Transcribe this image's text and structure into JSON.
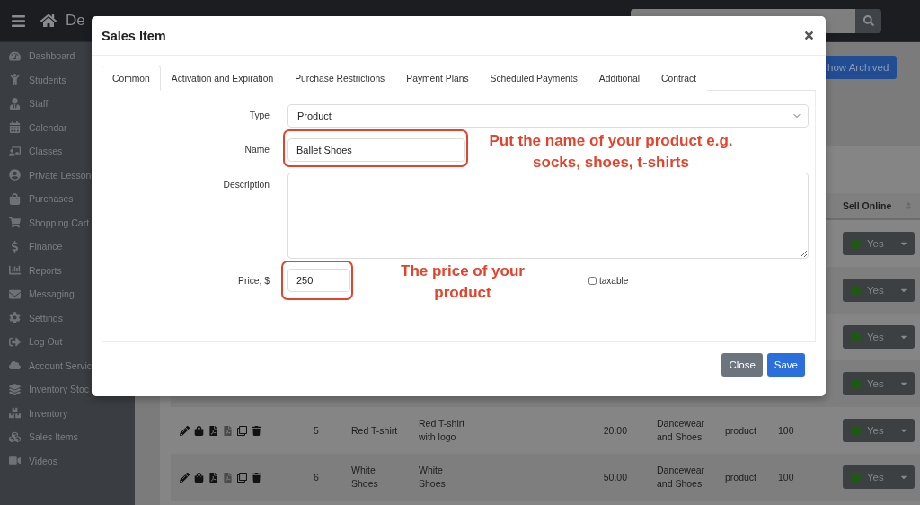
{
  "topbar": {
    "brand": "De"
  },
  "sidebar": {
    "items": [
      {
        "label": "Dashboard"
      },
      {
        "label": "Students"
      },
      {
        "label": "Staff"
      },
      {
        "label": "Calendar"
      },
      {
        "label": "Classes"
      },
      {
        "label": "Private Lesson"
      },
      {
        "label": "Purchases"
      },
      {
        "label": "Shopping Cart"
      },
      {
        "label": "Finance"
      },
      {
        "label": "Reports"
      },
      {
        "label": "Messaging"
      },
      {
        "label": "Settings"
      },
      {
        "label": "Log Out"
      },
      {
        "label": "Account Servic"
      },
      {
        "label": "Inventory Stoc"
      },
      {
        "label": "Inventory"
      },
      {
        "label": "Sales Items"
      },
      {
        "label": "Videos"
      }
    ]
  },
  "content": {
    "archived_button": "how Archived",
    "table": {
      "columns": [
        {
          "label": "Sell Online"
        }
      ],
      "rows": [
        {
          "kind": "covered",
          "sell_online": "Yes",
          "online": true
        },
        {
          "kind": "covered",
          "sell_online": "Yes",
          "online": true
        },
        {
          "kind": "covered",
          "sell_online": "Yes",
          "online": true
        },
        {
          "kind": "covered",
          "sell_online": "Yes",
          "online": true
        },
        {
          "kind": "full",
          "id": "5",
          "name": "Red T-shirt",
          "description": "Red T-shirt with logo",
          "price": "20.00",
          "category": "Dancewear and Shoes",
          "type": "product",
          "stock": "100",
          "sell_online": "Yes",
          "online": true
        },
        {
          "kind": "full",
          "id": "6",
          "name": "White Shoes",
          "description": "White Shoes",
          "price": "50.00",
          "category": "Dancewear and Shoes",
          "type": "product",
          "stock": "100",
          "sell_online": "Yes",
          "online": true
        }
      ]
    }
  },
  "modal": {
    "title": "Sales Item",
    "tabs": [
      {
        "label": "Common",
        "selected": true
      },
      {
        "label": "Activation and Expiration",
        "selected": false
      },
      {
        "label": "Purchase Restrictions",
        "selected": false
      },
      {
        "label": "Payment Plans",
        "selected": false
      },
      {
        "label": "Scheduled Payments",
        "selected": false
      },
      {
        "label": "Additional",
        "selected": false
      },
      {
        "label": "Contract",
        "selected": false
      }
    ],
    "form": {
      "type": {
        "label": "Type",
        "value": "Product"
      },
      "name": {
        "label": "Name",
        "value": "Ballet Shoes"
      },
      "description": {
        "label": "Description"
      },
      "price": {
        "label": "Price, $",
        "value": "250"
      },
      "taxable": {
        "label": "taxable",
        "checked": false
      }
    },
    "buttons": [
      {
        "label": "Close",
        "kind": "secondary"
      },
      {
        "label": "Save",
        "kind": "primary"
      }
    ]
  },
  "annotations": [
    {
      "text": "Put the name of your product e.g. socks, shoes, t-shirts"
    },
    {
      "text": "The price of your product"
    }
  ]
}
